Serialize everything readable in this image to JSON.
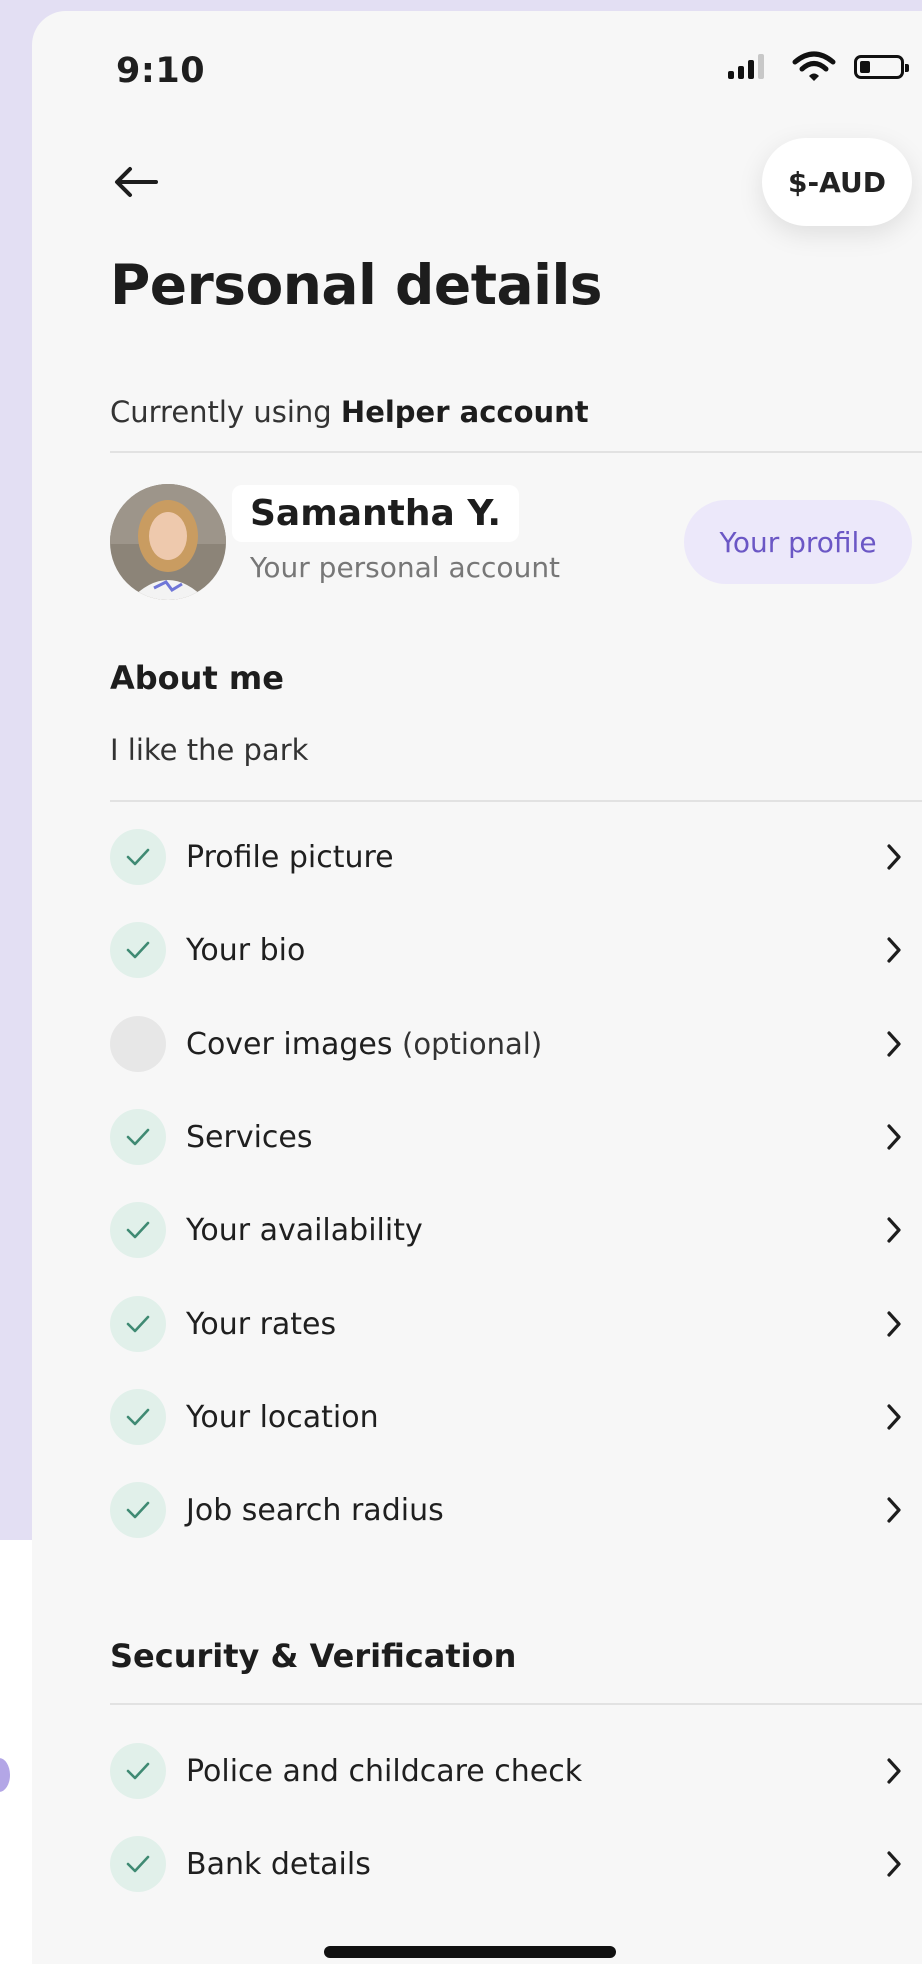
{
  "status_bar": {
    "time": "9:10"
  },
  "header": {
    "currency_label": "$-AUD"
  },
  "page": {
    "title": "Personal details"
  },
  "account": {
    "prefix": "Currently using",
    "type": "Helper account",
    "name": "Samantha Y.",
    "subtitle": "Your personal account",
    "profile_button": "Your profile"
  },
  "about": {
    "heading": "About me",
    "text": "I like the park"
  },
  "profile_items": [
    {
      "label": "Profile picture",
      "complete": true
    },
    {
      "label": "Your bio",
      "complete": true
    },
    {
      "label": "Cover images",
      "suffix": "(optional)",
      "complete": false
    },
    {
      "label": "Services",
      "complete": true
    },
    {
      "label": "Your availability",
      "complete": true
    },
    {
      "label": "Your rates",
      "complete": true
    },
    {
      "label": "Your location",
      "complete": true
    },
    {
      "label": "Job search radius",
      "complete": true
    }
  ],
  "security": {
    "heading": "Security & Verification",
    "items": [
      {
        "label": "Police and childcare check",
        "complete": true
      },
      {
        "label": "Bank details",
        "complete": true
      }
    ]
  },
  "colors": {
    "accent": "#6b57c5",
    "accent_bg": "#ece8fa",
    "check_bg": "#e1f0ea",
    "check_mark": "#3f8a73"
  }
}
